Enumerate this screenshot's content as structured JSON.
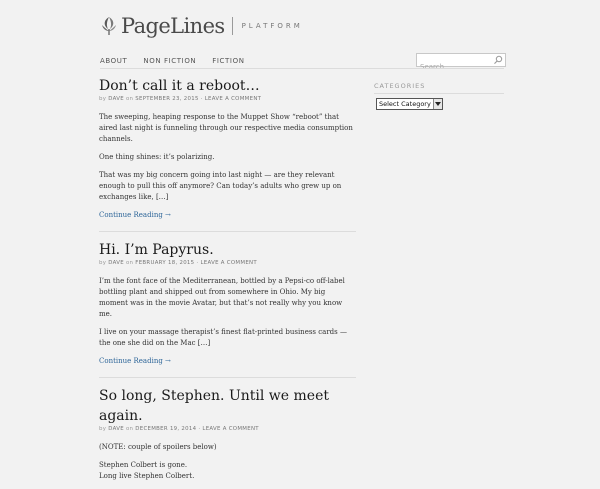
{
  "header": {
    "logo_text": "PageLines",
    "tagline": "PLATFORM"
  },
  "nav": {
    "items": [
      {
        "label": "ABOUT"
      },
      {
        "label": "NON FICTION"
      },
      {
        "label": "FICTION"
      }
    ]
  },
  "search": {
    "placeholder": "Search"
  },
  "sidebar": {
    "categories_title": "CATEGORIES",
    "select_label": "Select Category"
  },
  "posts": [
    {
      "title": "Don’t call it a reboot…",
      "by": "by",
      "author": "DAVE",
      "on": "on",
      "date": "SEPTEMBER 23, 2015",
      "comment": "· LEAVE A COMMENT",
      "paragraphs": [
        "The sweeping, heaping response to the Muppet Show “reboot” that aired last night is funneling through our respective media consumption channels.",
        "One thing shines: it’s polarizing.",
        "That was my big concern going into last night — are they relevant enough to pull this off anymore? Can today’s adults who grew up on exchanges like, […]"
      ],
      "more": "Continue Reading →"
    },
    {
      "title": "Hi. I’m Papyrus.",
      "by": "by",
      "author": "DAVE",
      "on": "on",
      "date": "FEBRUARY 18, 2015",
      "comment": "· LEAVE A COMMENT",
      "paragraphs": [
        "I’m the font face of the Mediterranean, bottled by a Pepsi-co off-label bottling plant and shipped out from somewhere in Ohio. My big moment was in the movie Avatar, but that’s not really why you know me.",
        "I live on your massage therapist’s finest flat-printed business cards — the one she did on the Mac […]"
      ],
      "more": "Continue Reading →"
    },
    {
      "title": "So long, Stephen. Until we meet again.",
      "by": "by",
      "author": "DAVE",
      "on": "on",
      "date": "DECEMBER 19, 2014",
      "comment": "· LEAVE A COMMENT",
      "paragraphs": [
        "(NOTE: couple of spoilers below)",
        "Stephen Colbert is gone.",
        "Long live Stephen Colbert."
      ],
      "more": ""
    }
  ],
  "icons": {
    "logo": "pagelines-leaf-icon",
    "search": "search-icon",
    "select": "chevron-down-icon"
  }
}
